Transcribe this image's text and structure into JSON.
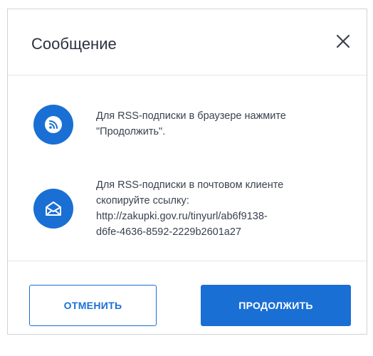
{
  "dialog": {
    "title": "Сообщение",
    "close_icon": "close-icon",
    "rss": {
      "icon": "rss-icon",
      "line1": "Для RSS-подписки в браузере нажмите",
      "line2": "\"Продолжить\"."
    },
    "email": {
      "icon": "envelope-icon",
      "line1": "Для RSS-подписки в почтовом клиенте",
      "line2": "скопируйте ссылку:",
      "line3": "http://zakupki.gov.ru/tinyurl/ab6f9138-",
      "line4": "d6fe-4636-8592-2229b2601a27"
    },
    "buttons": {
      "cancel": "ОТМЕНИТЬ",
      "continue": "ПРОДОЛЖИТЬ"
    }
  },
  "colors": {
    "accent": "#1a6fd4",
    "text": "#3a4150"
  }
}
